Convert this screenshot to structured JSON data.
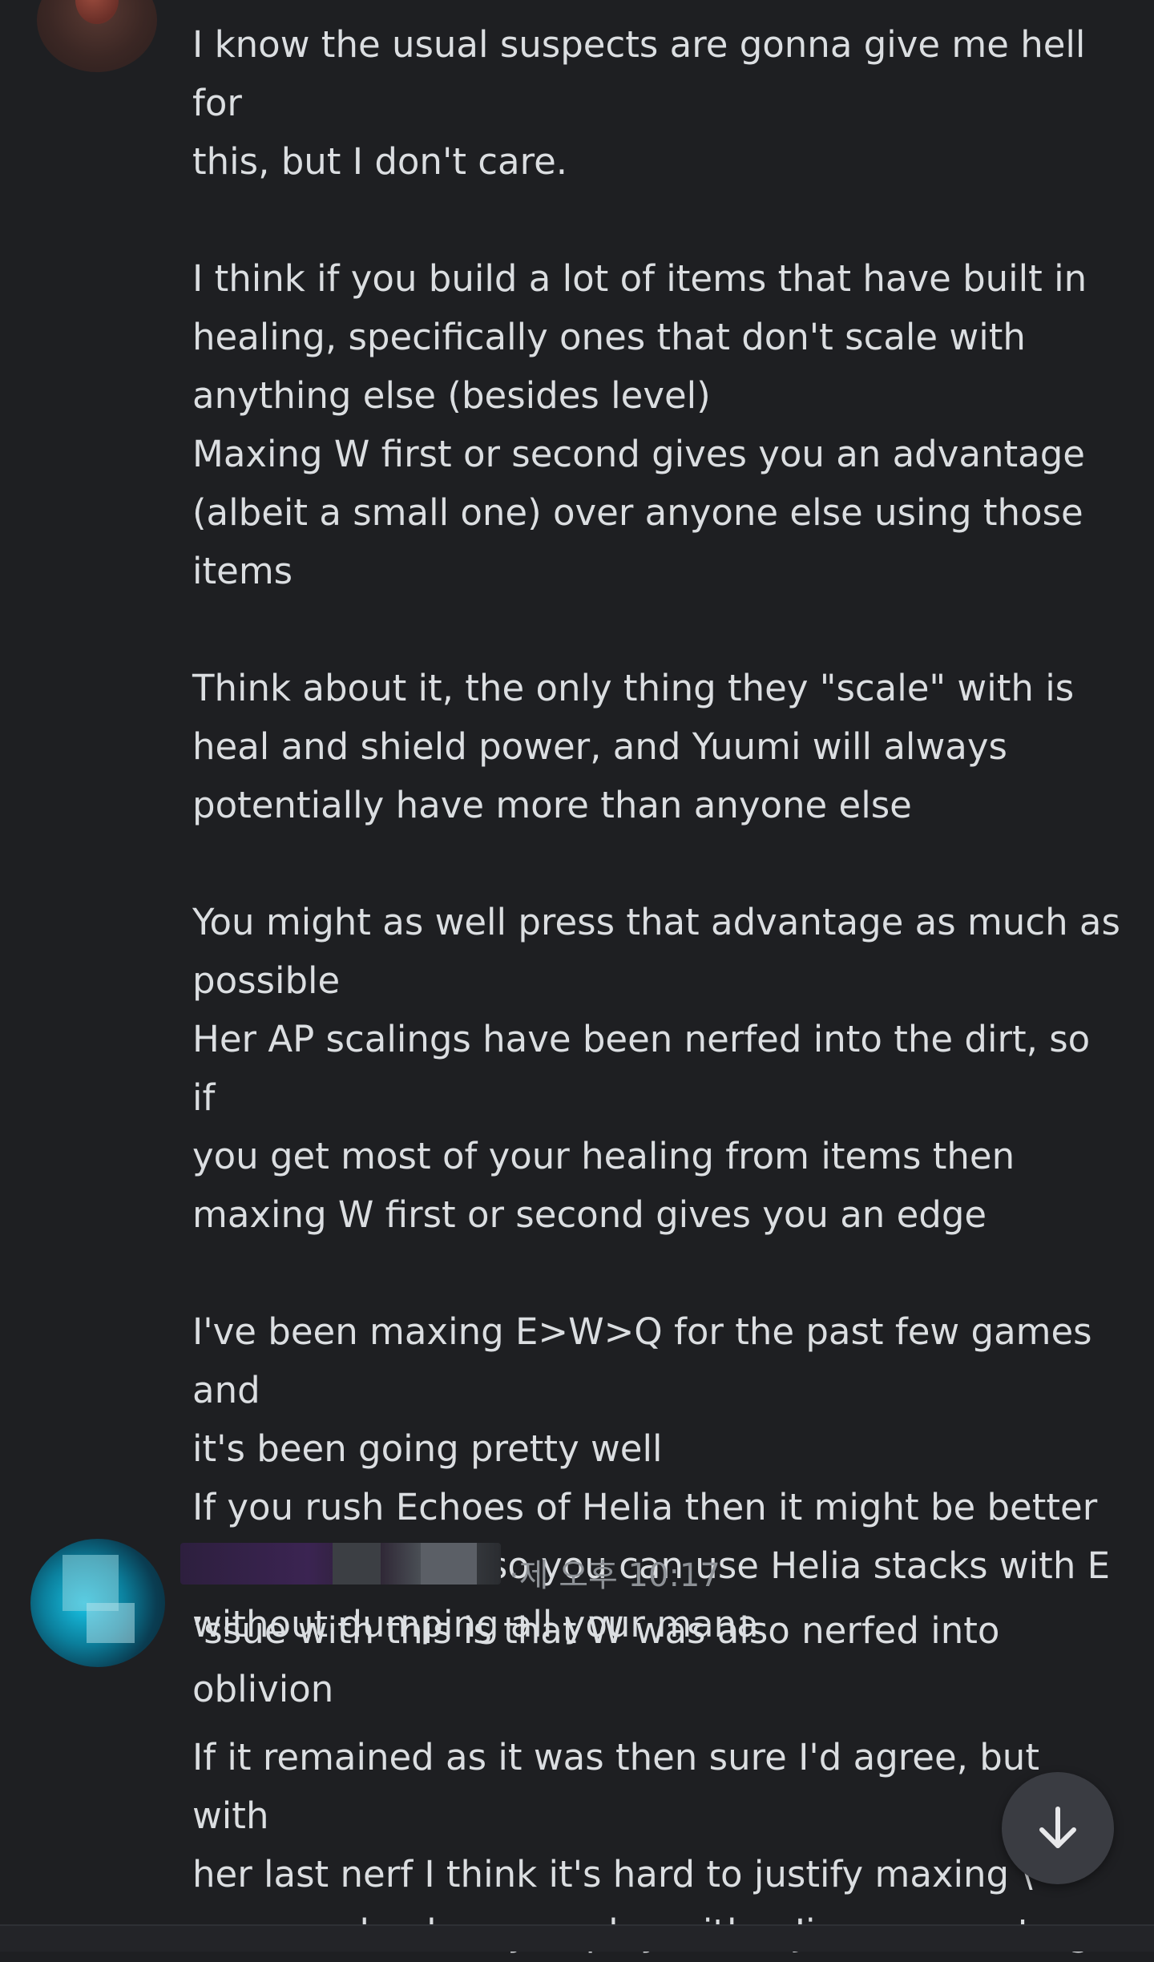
{
  "messages": [
    {
      "username": "",
      "timestamp": "",
      "paragraphs": [
        "I know the usual suspects are gonna give me hell for\nthis, but I don't care.\n\nI think if you build a lot of items that have built in\nhealing, specifically ones that don't scale with\nanything else (besides level)\nMaxing W first or second gives you an advantage\n(albeit a small one) over anyone else using those\nitems\n\nThink about it, the only thing they \"scale\" with is\nheal and shield power, and Yuumi will always\npotentially have more than anyone else\n\nYou might as well press that advantage as much as\npossible\nHer AP scalings have been nerfed into the dirt, so if\nyou get most of your healing from items then\nmaxing W first or second gives you an edge\n\nI've been maxing E>W>Q for the past few games and\nit's been going pretty well\nIf you rush Echoes of Helia then it might be better\nto max Q>W>E so you can use Helia stacks with E\nwithout dumping all your mana"
      ]
    },
    {
      "username": "",
      "timestamp": "·제 오후 10:17",
      "paragraphs": [
        "ʼssue with this is that W was also nerfed into\noblivion",
        "If it remained as it was then sure I'd agree, but with\nher last nerf I think it's hard to justify maxing \\\nor second unless you play with a Jinx or somet…g"
      ]
    }
  ],
  "icons": {
    "scroll_down": "arrow-down-icon"
  },
  "colors": {
    "background": "#1e1f22",
    "text": "#dbdee1",
    "muted": "#8e9297",
    "username_1": "#e67e3e",
    "scroll_button": "#3a3c42"
  }
}
